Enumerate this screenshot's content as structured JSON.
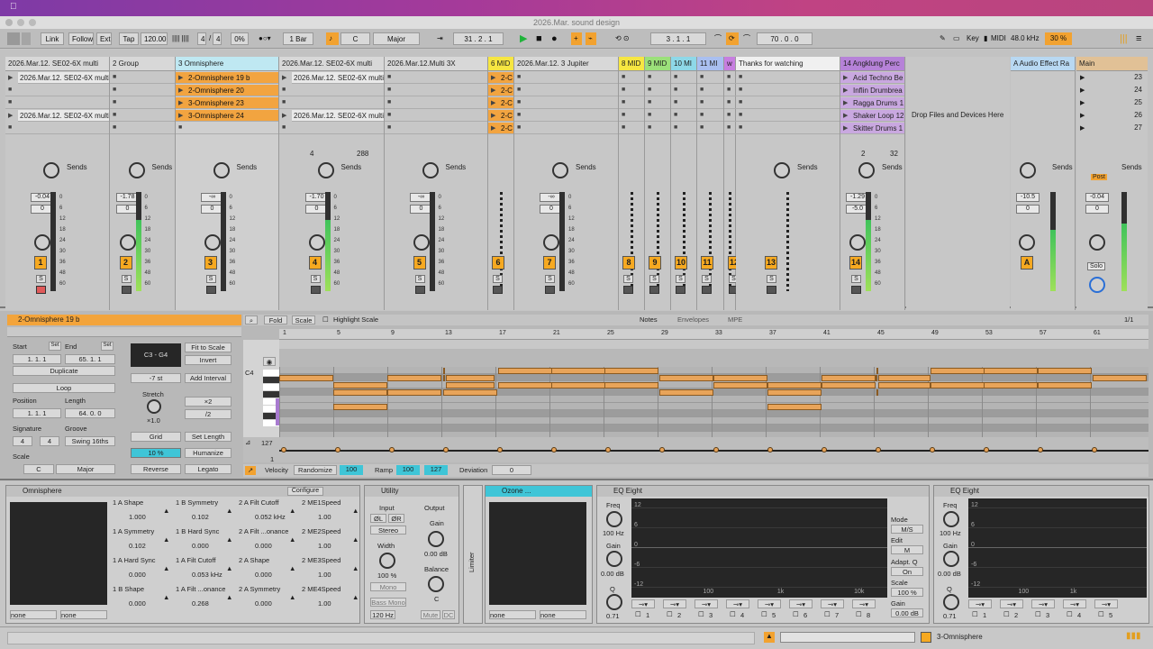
{
  "window": {
    "title": "2026.Mar. sound design"
  },
  "control": {
    "link": "Link",
    "follow": "Follow",
    "ext": "Ext",
    "tap": "Tap",
    "tempo": "120.00",
    "sig_num": "4",
    "sig_den": "4",
    "swing": "0%",
    "quant": "1 Bar",
    "key": "C",
    "scale": "Major",
    "pos": "31 .  2 .  1",
    "loop_start": "3 .  1 .  1",
    "loop_len": "70 .  0 .  0",
    "key_label": "Key",
    "midi_label": "MIDI",
    "sample_rate": "48.0 kHz",
    "cpu": "30 %"
  },
  "tracks": [
    {
      "name": "2026.Mar.12. SE02-6X multi",
      "slots": [
        "2026.Mar.12. SE02-6X multi",
        "",
        "",
        "2026.Mar.12. SE02-6X multi",
        ""
      ],
      "vol": "-0.04",
      "pan": "0",
      "num": "1",
      "color": "#d8d8d8"
    },
    {
      "name": "2 Group",
      "slots": [
        "",
        "",
        "",
        "",
        ""
      ],
      "vol": "-1.78",
      "pan": "0",
      "num": "2",
      "color": "#d8d8d8"
    },
    {
      "name": "3 Omnisphere",
      "slots": [
        "2-Omnisphere 19 b",
        "2-Omnisphere 20",
        "3-Omnisphere 23",
        "3-Omnisphere 24",
        ""
      ],
      "vol": "-∞",
      "pan": "0",
      "num": "3",
      "color": "#bfe8f2"
    },
    {
      "name": "2026.Mar.12. SE02-6X multi",
      "slots": [
        "2026.Mar.12. SE02-6X multi",
        "",
        "",
        "2026.Mar.12. SE02-6X multi",
        ""
      ],
      "vol": "-1.70",
      "pan": "0",
      "num": "4",
      "color": "#d8d8d8"
    },
    {
      "name": "2026.Mar.12.Multi 3X",
      "slots": [
        "",
        "",
        "",
        "",
        ""
      ],
      "vol": "-∞",
      "pan": "0",
      "num": "5",
      "color": "#d8d8d8"
    },
    {
      "name": "6 MID",
      "slots": [
        "2-C",
        "2-C",
        "2-C",
        "2-C",
        "2-C"
      ],
      "vol": "",
      "pan": "",
      "num": "6",
      "color": "#f6e642"
    },
    {
      "name": "2026.Mar.12. 3 Jupiter",
      "slots": [
        "",
        "",
        "",
        "",
        ""
      ],
      "vol": "-∞",
      "pan": "0",
      "num": "7",
      "color": "#d8d8d8"
    },
    {
      "name": "8 MID",
      "slots": [
        "",
        "",
        "",
        "",
        ""
      ],
      "vol": "",
      "pan": "",
      "num": "8",
      "color": "#f6e642"
    },
    {
      "name": "9 MID",
      "slots": [
        "",
        "",
        "",
        "",
        ""
      ],
      "vol": "",
      "pan": "",
      "num": "9",
      "color": "#9be07a"
    },
    {
      "name": "10 MI",
      "slots": [
        "",
        "",
        "",
        "",
        ""
      ],
      "vol": "",
      "pan": "",
      "num": "10",
      "color": "#8ed8e8"
    },
    {
      "name": "11 MI",
      "slots": [
        "",
        "",
        "",
        "",
        ""
      ],
      "vol": "",
      "pan": "",
      "num": "11",
      "color": "#a9bff0"
    },
    {
      "name": "w",
      "slots": [
        "",
        "",
        "",
        "",
        ""
      ],
      "vol": "",
      "pan": "",
      "num": "12",
      "color": "#c77ee0"
    },
    {
      "name": "Thanks for watching",
      "slots": [
        "",
        "",
        "",
        "",
        ""
      ],
      "vol": "",
      "pan": "",
      "num": "13",
      "color": "#f0f0f0"
    },
    {
      "name": "14 Angklung Perc",
      "slots": [
        "Acid Techno Be",
        "Inflin Drumbrea",
        "Ragga Drums 1",
        "Shaker Loop 12",
        "Skitter Drums 1"
      ],
      "vol": "-1.29",
      "pan": "-5.0",
      "num": "14",
      "color": "#b682d8"
    }
  ],
  "drop_text": "Drop Files and Devices Here",
  "return_a": {
    "name": "A Audio Effect Ra",
    "vol": "-10.5",
    "pan": "0",
    "num": "A"
  },
  "master": {
    "name": "Main",
    "vol": "-0.04",
    "pan": "0",
    "scenes": [
      "23",
      "24",
      "25",
      "26",
      "27"
    ],
    "solo": "Solo",
    "post": "Post"
  },
  "sends_label": "Sends",
  "scene_bar": {
    "n1": "4",
    "n2": "288",
    "n3": "2",
    "n4": "32"
  },
  "db_ticks": [
    "0",
    "6",
    "12",
    "18",
    "24",
    "30",
    "36",
    "48",
    "60"
  ],
  "clip": {
    "title": "2-Omnisphere 19 b",
    "start_label": "Start",
    "end_label": "End",
    "set": "Set",
    "start": "1.   1.   1",
    "end": "65.   1.   1",
    "duplicate": "Duplicate",
    "loop": "Loop",
    "position_label": "Position",
    "length_label": "Length",
    "position": "1.   1.   1",
    "length": "64.   0.   0",
    "signature_label": "Signature",
    "groove_label": "Groove",
    "sig1": "4",
    "sig2": "4",
    "groove": "Swing 16ths",
    "scale_label": "Scale",
    "scale_key": "C",
    "scale_mode": "Major",
    "range": "C3 - G4",
    "fit": "Fit to Scale",
    "invert": "Invert",
    "semi": "-7 st",
    "add_interval": "Add Interval",
    "stretch": "Stretch",
    "x2": "×2",
    "div2": "/2",
    "stretch_val": "×1.0",
    "grid": "Grid",
    "set_length": "Set Length",
    "pct": "10 %",
    "humanize": "Humanize",
    "reverse": "Reverse",
    "legato": "Legato",
    "fold": "Fold",
    "scale_btn": "Scale",
    "highlight": "Highlight Scale",
    "notes": "Notes",
    "envelopes": "Envelopes",
    "mpe": "MPE",
    "page": "1/1",
    "c4": "C4",
    "vel_max": "127",
    "vel_min": "1",
    "velocity": "Velocity",
    "randomize": "Randomize",
    "vel_val": "100",
    "ramp": "Ramp",
    "ramp1": "100",
    "ramp2": "127",
    "deviation": "Deviation",
    "dev_val": "0",
    "ruler": [
      "1",
      "5",
      "9",
      "13",
      "17",
      "21",
      "25",
      "29",
      "33",
      "37",
      "41",
      "45",
      "49",
      "53",
      "57",
      "61"
    ]
  },
  "devices": {
    "omni": {
      "name": "Omnisphere",
      "configure": "Configure",
      "params": [
        [
          "1 A Shape",
          "1.000"
        ],
        [
          "1 B Symmetry",
          "0.102"
        ],
        [
          "2 A Filt Cutoff",
          "0.052 kHz"
        ],
        [
          "2 ME1Speed",
          "1.00"
        ],
        [
          "1 A Symmetry",
          "0.102"
        ],
        [
          "1 B Hard Sync",
          "0.000"
        ],
        [
          "2 A Filt ...onance",
          "0.000"
        ],
        [
          "2 ME2Speed",
          "1.00"
        ],
        [
          "1 A Hard Sync",
          "0.000"
        ],
        [
          "1 A Filt Cutoff",
          "0.053 kHz"
        ],
        [
          "2 A Shape",
          "0.000"
        ],
        [
          "2 ME3Speed",
          "1.00"
        ],
        [
          "1 B Shape",
          "0.000"
        ],
        [
          "1 A Filt ...onance",
          "0.268"
        ],
        [
          "2 A Symmetry",
          "0.000"
        ],
        [
          "2 ME4Speed",
          "1.00"
        ]
      ],
      "none1": "none",
      "none2": "none"
    },
    "utility": {
      "name": "Utility",
      "input": "Input",
      "output": "Output",
      "phl": "ØL",
      "phr": "ØR",
      "stereo": "Stereo",
      "gain": "Gain",
      "gain_val": "0.00 dB",
      "width": "Width",
      "width_val": "100 %",
      "balance": "Balance",
      "balance_val": "C",
      "mono": "Mono",
      "bassmono": "Bass Mono",
      "hz": "120 Hz",
      "mute": "Mute",
      "dc": "DC"
    },
    "limiter": "Limiter",
    "ozone": {
      "name": "Ozone ...",
      "none1": "none",
      "none2": "none"
    },
    "eq1": {
      "name": "EQ Eight",
      "freq": "Freq",
      "freq_val": "100 Hz",
      "gain": "Gain",
      "gain_val": "0.00 dB",
      "q": "Q",
      "q_val": "0.71",
      "mode": "Mode",
      "mode_val": "M/S",
      "edit": "Edit",
      "edit_val": "M",
      "adapt": "Adapt. Q",
      "adapt_val": "On",
      "scale": "Scale",
      "scale_val": "100 %",
      "gain2": "Gain",
      "gain2_val": "0.00 dB",
      "db": [
        "12",
        "6",
        "0",
        "-6",
        "-12"
      ],
      "hz": [
        "100",
        "1k",
        "10k"
      ],
      "bands": [
        "1",
        "2",
        "3",
        "4",
        "5",
        "6",
        "7",
        "8"
      ]
    },
    "eq2": {
      "name": "EQ Eight",
      "freq": "Freq",
      "freq_val": "100 Hz",
      "gain": "Gain",
      "gain_val": "0.00 dB",
      "q": "Q",
      "q_val": "0.71",
      "db": [
        "12",
        "6",
        "0",
        "-6",
        "-12"
      ],
      "hz": [
        "100",
        "1k"
      ],
      "bands": [
        "1",
        "2",
        "3",
        "4",
        "5"
      ]
    }
  },
  "status": {
    "track": "3-Omnisphere"
  }
}
